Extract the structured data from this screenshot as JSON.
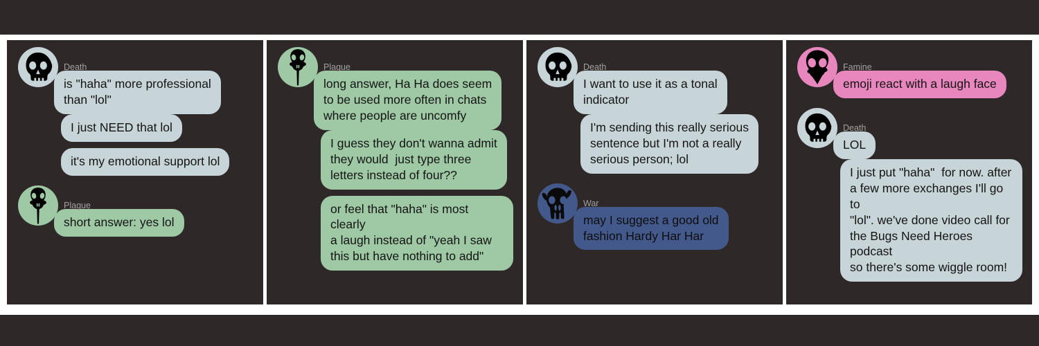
{
  "page": {
    "background_color": "#2e2829",
    "divider_color": "#ffffff"
  },
  "avatars": {
    "death": {
      "name": "Death",
      "icon": "human-skull-icon",
      "circle_color": "#c7d4d8",
      "glyph_color": "#000000"
    },
    "plague": {
      "name": "Plague",
      "icon": "bird-skull-icon",
      "circle_color": "#9ec9a4",
      "glyph_color": "#000000"
    },
    "war": {
      "name": "War",
      "icon": "animal-skull-icon",
      "circle_color": "#44598b",
      "glyph_color": "#0a0a0a"
    },
    "famine": {
      "name": "Famine",
      "icon": "crow-skull-icon",
      "circle_color": "#e887bd",
      "glyph_color": "#000000"
    }
  },
  "bubble_colors": {
    "gray": "#c7d4d8",
    "green": "#9ec9a4",
    "blue": "#44598b",
    "pink": "#e887bd"
  },
  "panels": [
    {
      "id": "panel-1",
      "messages": [
        {
          "sender": "Death",
          "avatar": "death",
          "show_avatar": true,
          "color": "gray",
          "text": "is \"haha\" more professional\nthan \"lol\""
        },
        {
          "sender": "Death",
          "avatar": "death",
          "show_avatar": false,
          "color": "gray",
          "text": "I just NEED that lol"
        },
        {
          "sender": "Death",
          "avatar": "death",
          "show_avatar": false,
          "color": "gray",
          "text": "it's my emotional support lol"
        },
        {
          "sender": "Plague",
          "avatar": "plague",
          "show_avatar": true,
          "color": "green",
          "text": "short answer: yes lol"
        }
      ]
    },
    {
      "id": "panel-2",
      "messages": [
        {
          "sender": "Plague",
          "avatar": "plague",
          "show_avatar": true,
          "color": "green",
          "text": "long answer, Ha Ha does seem\nto be used more often in chats\nwhere people are uncomfy"
        },
        {
          "sender": "Plague",
          "avatar": "plague",
          "show_avatar": false,
          "color": "green",
          "text": "I guess they don't wanna admit\nthey would  just type three\nletters instead of four??"
        },
        {
          "sender": "Plague",
          "avatar": "plague",
          "show_avatar": false,
          "color": "green",
          "text": "or feel that \"haha\" is most clearly\na laugh instead of \"yeah I saw\nthis but have nothing to add\""
        }
      ]
    },
    {
      "id": "panel-3",
      "messages": [
        {
          "sender": "Death",
          "avatar": "death",
          "show_avatar": true,
          "color": "gray",
          "text": "I want to use it as a tonal\nindicator"
        },
        {
          "sender": "Death",
          "avatar": "death",
          "show_avatar": false,
          "color": "gray",
          "text": "I'm sending this really serious\nsentence but I'm not a really\nserious person; lol"
        },
        {
          "sender": "War",
          "avatar": "war",
          "show_avatar": true,
          "color": "blue",
          "text": "may I suggest a good old\nfashion Hardy Har Har"
        }
      ]
    },
    {
      "id": "panel-4",
      "messages": [
        {
          "sender": "Famine",
          "avatar": "famine",
          "show_avatar": true,
          "color": "pink",
          "text": "emoji react with a laugh face"
        },
        {
          "sender": "Death",
          "avatar": "death",
          "show_avatar": true,
          "color": "gray",
          "text": "LOL"
        },
        {
          "sender": "Death",
          "avatar": "death",
          "show_avatar": false,
          "color": "gray",
          "text": "I just put \"haha\"  for now. after\na few more exchanges I'll go to\n\"lol\". we've done video call for\nthe Bugs Need Heroes podcast\nso there's some wiggle room!"
        }
      ]
    }
  ]
}
